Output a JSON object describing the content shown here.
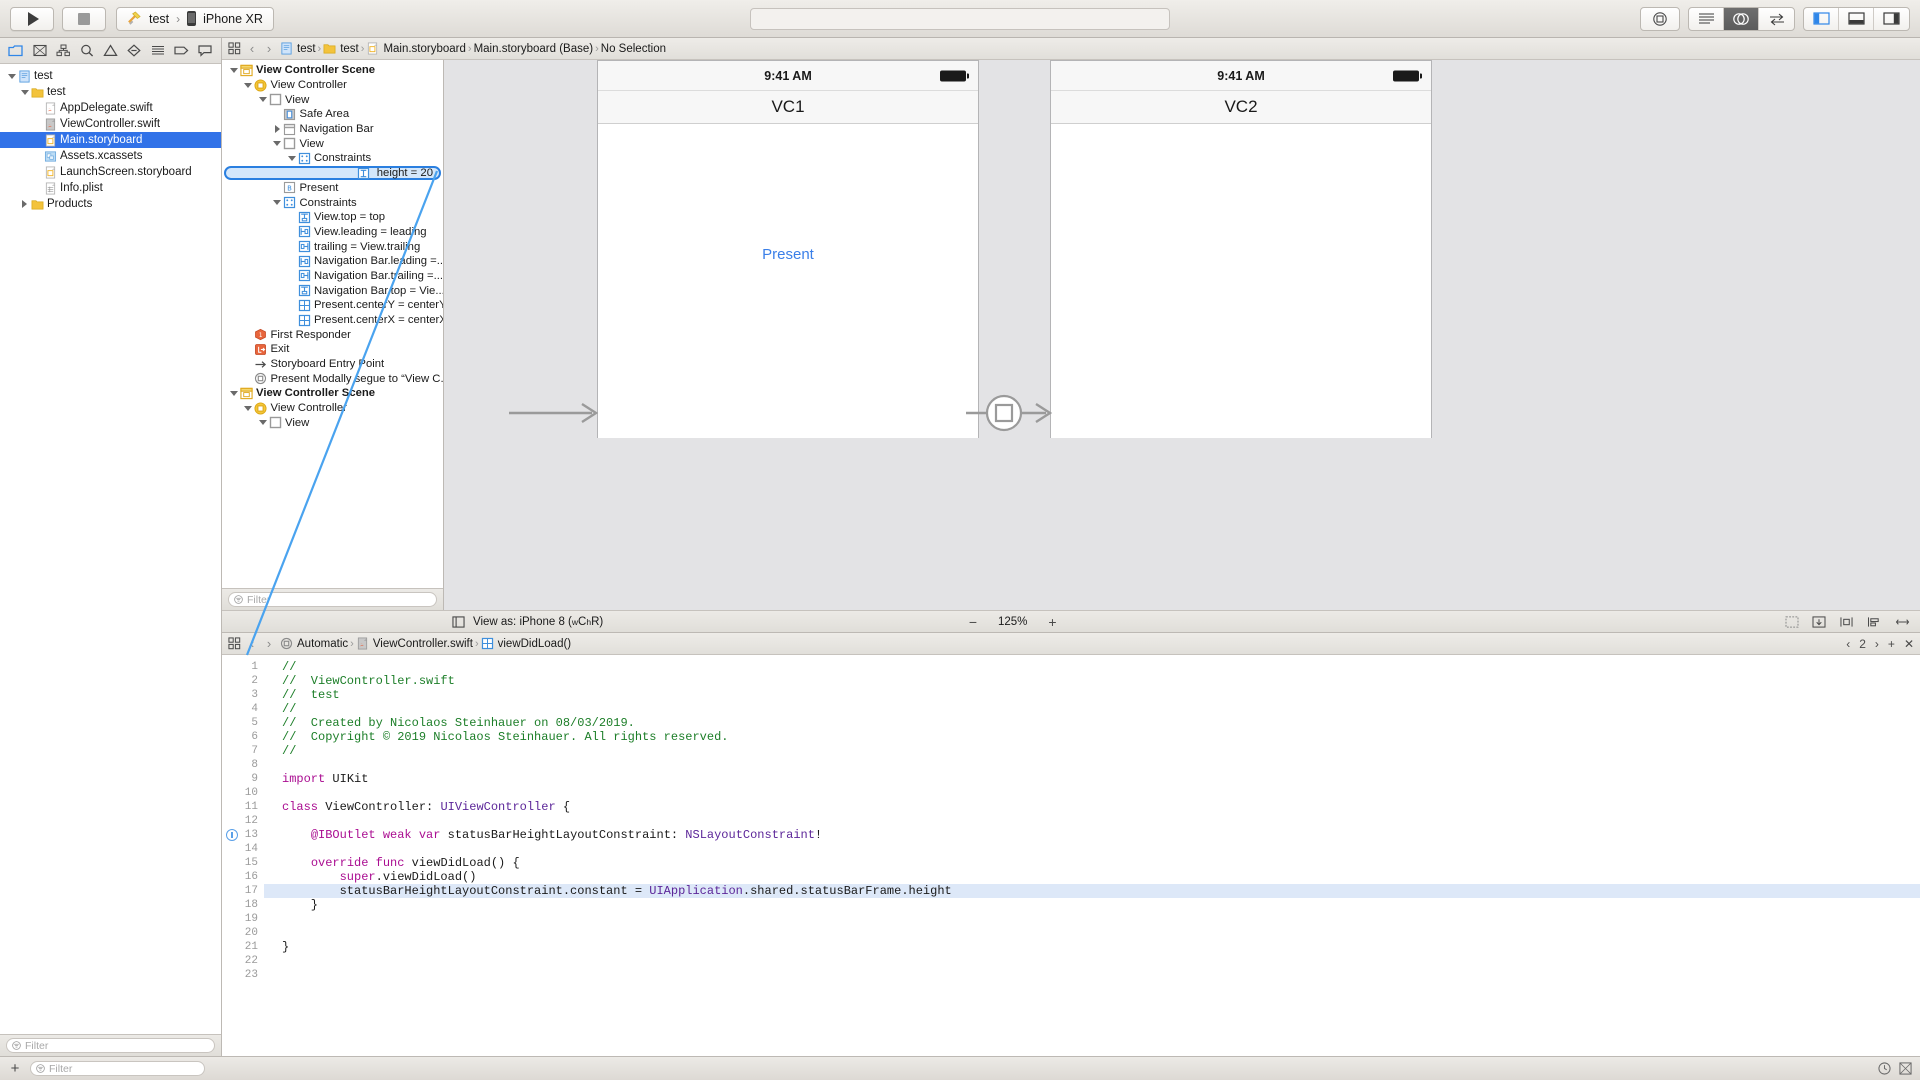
{
  "toolbar": {
    "run_label": "run-button",
    "stop_label": "stop-button",
    "scheme_name": "test",
    "destination": "iPhone XR",
    "search_placeholder": ""
  },
  "navigator": {
    "tabs": [
      "folder-icon",
      "warning-triangle-icon",
      "hierarchy-icon",
      "search-icon",
      "issue-icon",
      "minus-diamond-icon",
      "list-icon",
      "tag-icon",
      "comment-icon"
    ],
    "items": [
      {
        "label": "test",
        "depth": 0,
        "twist": "open",
        "icon": "project-icon",
        "selected": false
      },
      {
        "label": "test",
        "depth": 1,
        "twist": "open",
        "icon": "folder-icon",
        "selected": false
      },
      {
        "label": "AppDelegate.swift",
        "depth": 2,
        "twist": "none",
        "icon": "swift-icon",
        "selected": false
      },
      {
        "label": "ViewController.swift",
        "depth": 2,
        "twist": "none",
        "icon": "swift-gray-icon",
        "selected": false
      },
      {
        "label": "Main.storyboard",
        "depth": 2,
        "twist": "none",
        "icon": "storyboard-icon",
        "selected": true
      },
      {
        "label": "Assets.xcassets",
        "depth": 2,
        "twist": "none",
        "icon": "assets-icon",
        "selected": false
      },
      {
        "label": "LaunchScreen.storyboard",
        "depth": 2,
        "twist": "none",
        "icon": "storyboard-icon",
        "selected": false
      },
      {
        "label": "Info.plist",
        "depth": 2,
        "twist": "none",
        "icon": "plist-icon",
        "selected": false
      },
      {
        "label": "Products",
        "depth": 1,
        "twist": "closed",
        "icon": "folder-icon",
        "selected": false
      }
    ],
    "filter_placeholder": "Filter"
  },
  "jumpbar": {
    "crumbs": [
      "test",
      "test",
      "Main.storyboard",
      "Main.storyboard (Base)",
      "No Selection"
    ],
    "back": "‹",
    "forward": "›"
  },
  "outline": {
    "rows": [
      {
        "label": "View Controller Scene",
        "depth": 0,
        "twist": "open",
        "icon": "scene-icon",
        "bold": true
      },
      {
        "label": "View Controller",
        "depth": 1,
        "twist": "open",
        "icon": "viewcontroller-icon"
      },
      {
        "label": "View",
        "depth": 2,
        "twist": "open",
        "icon": "view-icon"
      },
      {
        "label": "Safe Area",
        "depth": 3,
        "twist": "none",
        "icon": "safearea-icon"
      },
      {
        "label": "Navigation Bar",
        "depth": 3,
        "twist": "closed",
        "icon": "navbar-icon"
      },
      {
        "label": "View",
        "depth": 3,
        "twist": "open",
        "icon": "view-icon"
      },
      {
        "label": "Constraints",
        "depth": 4,
        "twist": "open",
        "icon": "constraints-icon"
      },
      {
        "label": "height = 20",
        "depth": 5,
        "twist": "none",
        "icon": "height-constraint-icon",
        "selected": true
      },
      {
        "label": "Present",
        "depth": 3,
        "twist": "none",
        "icon": "button-icon"
      },
      {
        "label": "Constraints",
        "depth": 3,
        "twist": "open",
        "icon": "constraints-icon"
      },
      {
        "label": "View.top = top",
        "depth": 4,
        "twist": "none",
        "icon": "constraint-top-icon"
      },
      {
        "label": "View.leading = leading",
        "depth": 4,
        "twist": "none",
        "icon": "constraint-leading-icon"
      },
      {
        "label": "trailing = View.trailing",
        "depth": 4,
        "twist": "none",
        "icon": "constraint-trailing-icon"
      },
      {
        "label": "Navigation Bar.leading =...",
        "depth": 4,
        "twist": "none",
        "icon": "constraint-leading-icon"
      },
      {
        "label": "Navigation Bar.trailing =...",
        "depth": 4,
        "twist": "none",
        "icon": "constraint-trailing-icon"
      },
      {
        "label": "Navigation Bar.top = Vie...",
        "depth": 4,
        "twist": "none",
        "icon": "constraint-top-icon"
      },
      {
        "label": "Present.centerY = centerY",
        "depth": 4,
        "twist": "none",
        "icon": "constraint-center-icon"
      },
      {
        "label": "Present.centerX = centerX",
        "depth": 4,
        "twist": "none",
        "icon": "constraint-center-icon"
      },
      {
        "label": "First Responder",
        "depth": 1,
        "twist": "none",
        "icon": "first-responder-icon"
      },
      {
        "label": "Exit",
        "depth": 1,
        "twist": "none",
        "icon": "exit-icon"
      },
      {
        "label": "Storyboard Entry Point",
        "depth": 1,
        "twist": "none",
        "icon": "entry-point-icon"
      },
      {
        "label": "Present Modally segue to “View C...",
        "depth": 1,
        "twist": "none",
        "icon": "segue-icon"
      },
      {
        "label": "View Controller Scene",
        "depth": 0,
        "twist": "open",
        "icon": "scene-icon",
        "bold": true
      },
      {
        "label": "View Controller",
        "depth": 1,
        "twist": "open",
        "icon": "viewcontroller-icon"
      },
      {
        "label": "View",
        "depth": 2,
        "twist": "open",
        "icon": "view-icon"
      }
    ],
    "filter_placeholder": "Filter"
  },
  "canvas": {
    "scenes": [
      {
        "title": "VC1",
        "time": "9:41 AM",
        "button": "Present"
      },
      {
        "title": "VC2",
        "time": "9:41 AM",
        "button": ""
      }
    ],
    "view_as": "View as: iPhone 8 (",
    "view_as_wc": "w",
    "view_as_c": "C ",
    "view_as_hr_h": "h",
    "view_as_hr_r": "R)",
    "zoom": "125%",
    "zoom_out": "−",
    "zoom_in": "+"
  },
  "code": {
    "crumbs": [
      "Automatic",
      "ViewController.swift",
      "viewDidLoad()"
    ],
    "page_counter": "2",
    "lines": [
      {
        "n": "1",
        "segs": [
          {
            "t": "//",
            "c": "cm"
          }
        ]
      },
      {
        "n": "2",
        "segs": [
          {
            "t": "//  ViewController.swift",
            "c": "cm"
          }
        ]
      },
      {
        "n": "3",
        "segs": [
          {
            "t": "//  test",
            "c": "cm"
          }
        ]
      },
      {
        "n": "4",
        "segs": [
          {
            "t": "//",
            "c": "cm"
          }
        ]
      },
      {
        "n": "5",
        "segs": [
          {
            "t": "//  Created by Nicolaos Steinhauer on 08/03/2019.",
            "c": "cm"
          }
        ]
      },
      {
        "n": "6",
        "segs": [
          {
            "t": "//  Copyright © 2019 Nicolaos Steinhauer. All rights reserved.",
            "c": "cm"
          }
        ]
      },
      {
        "n": "7",
        "segs": [
          {
            "t": "//",
            "c": "cm"
          }
        ]
      },
      {
        "n": "8",
        "segs": [
          {
            "t": "",
            "c": ""
          }
        ]
      },
      {
        "n": "9",
        "segs": [
          {
            "t": "import",
            "c": "kw"
          },
          {
            "t": " UIKit",
            "c": ""
          }
        ]
      },
      {
        "n": "10",
        "segs": [
          {
            "t": "",
            "c": ""
          }
        ]
      },
      {
        "n": "11",
        "segs": [
          {
            "t": "class",
            "c": "kw"
          },
          {
            "t": " ViewController: ",
            "c": ""
          },
          {
            "t": "UIViewController",
            "c": "ty"
          },
          {
            "t": " {",
            "c": ""
          }
        ]
      },
      {
        "n": "12",
        "segs": [
          {
            "t": "",
            "c": ""
          }
        ]
      },
      {
        "n": "13",
        "segs": [
          {
            "t": "    ",
            "c": ""
          },
          {
            "t": "@IBOutlet",
            "c": "at"
          },
          {
            "t": " ",
            "c": ""
          },
          {
            "t": "weak",
            "c": "kw"
          },
          {
            "t": " ",
            "c": ""
          },
          {
            "t": "var",
            "c": "kw"
          },
          {
            "t": " statusBarHeightLayoutConstraint: ",
            "c": ""
          },
          {
            "t": "NSLayoutConstraint",
            "c": "ty"
          },
          {
            "t": "!",
            "c": ""
          }
        ],
        "marker": true
      },
      {
        "n": "14",
        "segs": [
          {
            "t": "",
            "c": ""
          }
        ]
      },
      {
        "n": "15",
        "segs": [
          {
            "t": "    ",
            "c": ""
          },
          {
            "t": "override func",
            "c": "kw"
          },
          {
            "t": " viewDidLoad() {",
            "c": ""
          }
        ]
      },
      {
        "n": "16",
        "segs": [
          {
            "t": "        ",
            "c": ""
          },
          {
            "t": "super",
            "c": "kw"
          },
          {
            "t": ".viewDidLoad()",
            "c": ""
          }
        ]
      },
      {
        "n": "17",
        "segs": [
          {
            "t": "        statusBarHeightLayoutConstraint.constant = ",
            "c": ""
          },
          {
            "t": "UIApplication",
            "c": "ty"
          },
          {
            "t": ".shared.statusBarFrame.height",
            "c": ""
          }
        ],
        "highlight": true
      },
      {
        "n": "18",
        "segs": [
          {
            "t": "    }",
            "c": ""
          }
        ]
      },
      {
        "n": "19",
        "segs": [
          {
            "t": "",
            "c": ""
          }
        ]
      },
      {
        "n": "20",
        "segs": [
          {
            "t": "",
            "c": ""
          }
        ]
      },
      {
        "n": "21",
        "segs": [
          {
            "t": "}",
            "c": ""
          }
        ]
      },
      {
        "n": "22",
        "segs": [
          {
            "t": "",
            "c": ""
          }
        ]
      },
      {
        "n": "23",
        "segs": [
          {
            "t": "",
            "c": ""
          }
        ]
      }
    ]
  },
  "statusbar": {
    "add_label": "+",
    "filter_placeholder": "Filter"
  },
  "colors": {
    "selection_blue": "#3172e8",
    "wire_blue": "#4aa3ef",
    "comment_green": "#1c7e28",
    "keyword_magenta": "#aa0d91",
    "type_purple": "#5c2699",
    "link_blue": "#3a7fe8"
  }
}
